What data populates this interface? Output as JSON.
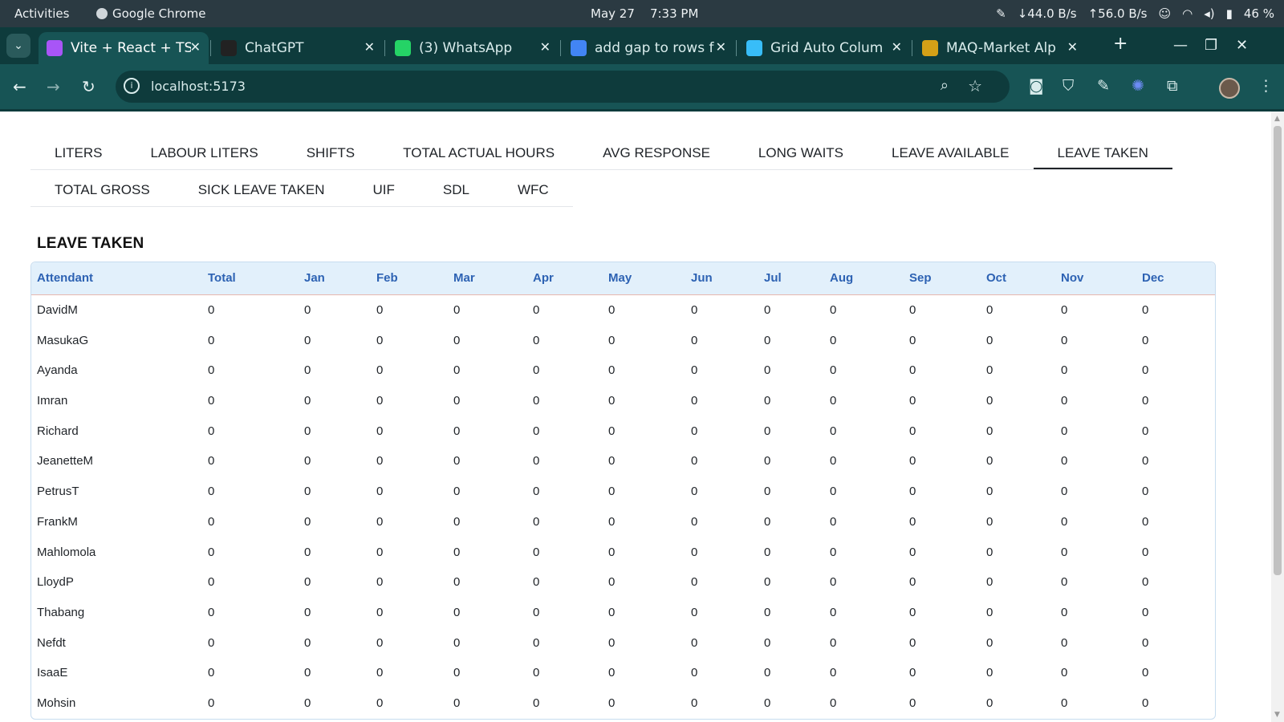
{
  "system_bar": {
    "activities": "Activities",
    "app_name": "Google Chrome",
    "date": "May 27",
    "time": "7:33 PM",
    "net_down": "↓44.0 B/s",
    "net_up": "↑56.0 B/s",
    "battery": "46 %"
  },
  "browser": {
    "tabs": [
      {
        "label": "Vite + React + TS",
        "icon": "vite-icon",
        "color": "#a855f7"
      },
      {
        "label": "ChatGPT",
        "icon": "chatgpt-icon",
        "color": "#222222"
      },
      {
        "label": "(3) WhatsApp",
        "icon": "whatsapp-icon",
        "color": "#25d366"
      },
      {
        "label": "add gap to rows f",
        "icon": "google-icon",
        "color": "#4285f4"
      },
      {
        "label": "Grid Auto Colum",
        "icon": "tailwind-icon",
        "color": "#38bdf8"
      },
      {
        "label": "MAQ-Market Alp",
        "icon": "maq-icon",
        "color": "#d4a017"
      }
    ],
    "new_tab": "+",
    "url": "localhost:5173"
  },
  "app": {
    "tabs_row1": [
      "LITERS",
      "LABOUR LITERS",
      "SHIFTS",
      "TOTAL ACTUAL HOURS",
      "AVG RESPONSE",
      "LONG WAITS",
      "LEAVE AVAILABLE",
      "LEAVE TAKEN"
    ],
    "tabs_row2": [
      "TOTAL GROSS",
      "SICK LEAVE TAKEN",
      "UIF",
      "SDL",
      "WFC"
    ],
    "selected_tab": "LEAVE TAKEN",
    "section_title": "LEAVE TAKEN",
    "table": {
      "columns": [
        "Attendant",
        "Total",
        "Jan",
        "Feb",
        "Mar",
        "Apr",
        "May",
        "Jun",
        "Jul",
        "Aug",
        "Sep",
        "Oct",
        "Nov",
        "Dec"
      ],
      "rows": [
        [
          "DavidM",
          "0",
          "0",
          "0",
          "0",
          "0",
          "0",
          "0",
          "0",
          "0",
          "0",
          "0",
          "0",
          "0"
        ],
        [
          "MasukaG",
          "0",
          "0",
          "0",
          "0",
          "0",
          "0",
          "0",
          "0",
          "0",
          "0",
          "0",
          "0",
          "0"
        ],
        [
          "Ayanda",
          "0",
          "0",
          "0",
          "0",
          "0",
          "0",
          "0",
          "0",
          "0",
          "0",
          "0",
          "0",
          "0"
        ],
        [
          "Imran",
          "0",
          "0",
          "0",
          "0",
          "0",
          "0",
          "0",
          "0",
          "0",
          "0",
          "0",
          "0",
          "0"
        ],
        [
          "Richard",
          "0",
          "0",
          "0",
          "0",
          "0",
          "0",
          "0",
          "0",
          "0",
          "0",
          "0",
          "0",
          "0"
        ],
        [
          "JeanetteM",
          "0",
          "0",
          "0",
          "0",
          "0",
          "0",
          "0",
          "0",
          "0",
          "0",
          "0",
          "0",
          "0"
        ],
        [
          "PetrusT",
          "0",
          "0",
          "0",
          "0",
          "0",
          "0",
          "0",
          "0",
          "0",
          "0",
          "0",
          "0",
          "0"
        ],
        [
          "FrankM",
          "0",
          "0",
          "0",
          "0",
          "0",
          "0",
          "0",
          "0",
          "0",
          "0",
          "0",
          "0",
          "0"
        ],
        [
          "Mahlomola",
          "0",
          "0",
          "0",
          "0",
          "0",
          "0",
          "0",
          "0",
          "0",
          "0",
          "0",
          "0",
          "0"
        ],
        [
          "LloydP",
          "0",
          "0",
          "0",
          "0",
          "0",
          "0",
          "0",
          "0",
          "0",
          "0",
          "0",
          "0",
          "0"
        ],
        [
          "Thabang",
          "0",
          "0",
          "0",
          "0",
          "0",
          "0",
          "0",
          "0",
          "0",
          "0",
          "0",
          "0",
          "0"
        ],
        [
          "Nefdt",
          "0",
          "0",
          "0",
          "0",
          "0",
          "0",
          "0",
          "0",
          "0",
          "0",
          "0",
          "0",
          "0"
        ],
        [
          "IsaaE",
          "0",
          "0",
          "0",
          "0",
          "0",
          "0",
          "0",
          "0",
          "0",
          "0",
          "0",
          "0",
          "0"
        ],
        [
          "Mohsin",
          "0",
          "0",
          "0",
          "0",
          "0",
          "0",
          "0",
          "0",
          "0",
          "0",
          "0",
          "0",
          "0"
        ]
      ]
    }
  }
}
